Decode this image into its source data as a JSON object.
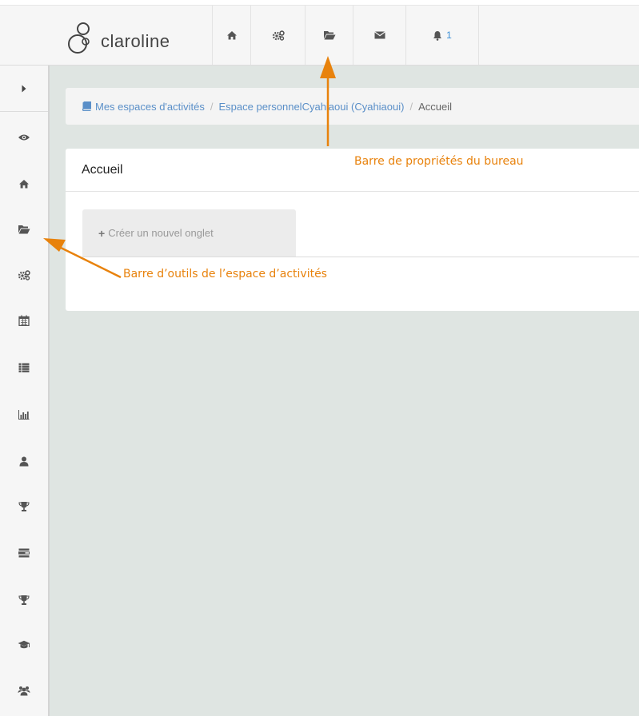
{
  "header": {
    "brand": "claroline",
    "nav": [
      {
        "icon": "home-icon"
      },
      {
        "icon": "cogs-icon"
      },
      {
        "icon": "folder-open-icon"
      },
      {
        "icon": "envelope-icon"
      },
      {
        "icon": "bell-icon",
        "badge": "1"
      }
    ]
  },
  "sidebar": {
    "toggle_icon": "caret-right-icon",
    "items": [
      {
        "icon": "eye-icon"
      },
      {
        "icon": "home-icon"
      },
      {
        "icon": "folder-open-icon"
      },
      {
        "icon": "cogs-icon"
      },
      {
        "icon": "calendar-icon"
      },
      {
        "icon": "list-icon"
      },
      {
        "icon": "bar-chart-icon"
      },
      {
        "icon": "user-icon"
      },
      {
        "icon": "trophy-icon"
      },
      {
        "icon": "tasks-icon"
      },
      {
        "icon": "trophy-icon"
      },
      {
        "icon": "graduation-cap-icon"
      },
      {
        "icon": "users-icon"
      }
    ]
  },
  "breadcrumb": {
    "icon": "book-icon",
    "items": [
      "Mes espaces d'activités",
      "Espace personnelCyahiaoui (Cyahiaoui)",
      "Accueil"
    ]
  },
  "panel": {
    "title": "Accueil",
    "new_tab_label": "Créer un nouvel onglet"
  },
  "annotations": {
    "top": "Barre de propriétés du bureau",
    "left": "Barre d’outils de l’espace d’activités"
  },
  "colors": {
    "annotation": "#e8820c",
    "link": "#5a8fc8",
    "badge": "#3a8ed6",
    "background": "#dfe5e2"
  }
}
